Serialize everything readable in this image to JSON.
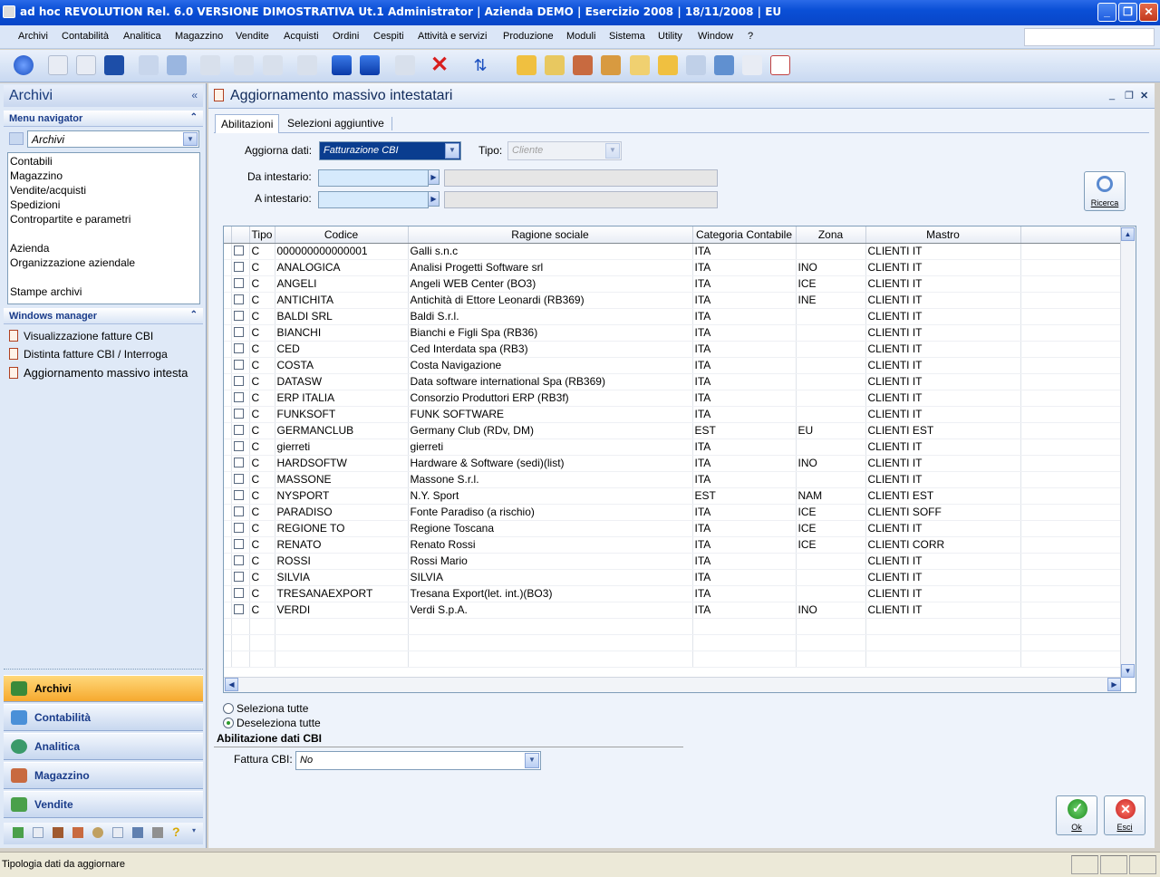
{
  "title_bar": {
    "title": "ad hoc REVOLUTION Rel. 6.0 VERSIONE DIMOSTRATIVA Ut.1 Administrator | Azienda DEMO | Esercizio 2008 | 18/11/2008 | EU"
  },
  "menu": [
    "Archivi",
    "Contabilità",
    "Analitica",
    "Magazzino",
    "Vendite",
    "Acquisti",
    "Ordini",
    "Cespiti",
    "Attività e servizi",
    "Produzione",
    "Moduli",
    "Sistema",
    "Utility",
    "Window",
    "?"
  ],
  "left_panel": {
    "title": "Archivi",
    "menu_navigator": {
      "label": "Menu navigator",
      "selected": "Archivi",
      "items": [
        "Contabili",
        "Magazzino",
        "Vendite/acquisti",
        "Spedizioni",
        "Contropartite e parametri",
        "Azienda",
        "Organizzazione aziendale",
        "Stampe archivi"
      ]
    },
    "windows_manager": {
      "label": "Windows manager",
      "items": [
        "Visualizzazione fatture CBI",
        "Distinta fatture CBI / Interroga",
        "Aggiornamento massivo intesta"
      ]
    },
    "modules": [
      "Archivi",
      "Contabilità",
      "Analitica",
      "Magazzino",
      "Vendite"
    ]
  },
  "main": {
    "title": "Aggiornamento massivo intestatari",
    "tabs": [
      "Abilitazioni",
      "Selezioni aggiuntive"
    ],
    "aggiorna_dati_label": "Aggiorna dati:",
    "aggiorna_dati_value": "Fatturazione CBI",
    "tipo_label": "Tipo:",
    "tipo_value": "Cliente",
    "da_intestario_label": "Da intestario:",
    "a_intestario_label": "A intestario:",
    "ricerca_label": "Ricerca",
    "grid": {
      "columns": [
        "Tipo",
        "Codice",
        "Ragione sociale",
        "Categoria Contabile",
        "Zona",
        "Mastro"
      ],
      "rows": [
        [
          "C",
          "000000000000001",
          "Galli s.n.c",
          "ITA",
          "",
          "CLIENTI IT"
        ],
        [
          "C",
          "ANALOGICA",
          "Analisi Progetti Software srl",
          "ITA",
          "INO",
          "CLIENTI IT"
        ],
        [
          "C",
          "ANGELI",
          "Angeli WEB Center  (BO3)",
          "ITA",
          "ICE",
          "CLIENTI IT"
        ],
        [
          "C",
          "ANTICHITA",
          "Antichità di Ettore Leonardi (RB369)",
          "ITA",
          "INE",
          "CLIENTI IT"
        ],
        [
          "C",
          "BALDI SRL",
          "Baldi S.r.l.",
          "ITA",
          "",
          "CLIENTI IT"
        ],
        [
          "C",
          "BIANCHI",
          "Bianchi e Figli Spa (RB36)",
          "ITA",
          "",
          "CLIENTI IT"
        ],
        [
          "C",
          "CED",
          "Ced Interdata spa (RB3)",
          "ITA",
          "",
          "CLIENTI IT"
        ],
        [
          "C",
          "COSTA",
          "Costa Navigazione",
          "ITA",
          "",
          "CLIENTI IT"
        ],
        [
          "C",
          "DATASW",
          "Data software international  Spa (RB369)",
          "ITA",
          "",
          "CLIENTI IT"
        ],
        [
          "C",
          "ERP ITALIA",
          "Consorzio Produttori ERP (RB3f)",
          "ITA",
          "",
          "CLIENTI IT"
        ],
        [
          "C",
          "FUNKSOFT",
          "FUNK SOFTWARE",
          "ITA",
          "",
          "CLIENTI IT"
        ],
        [
          "C",
          "GERMANCLUB",
          "Germany Club  (RDv, DM)",
          "EST",
          "EU",
          "CLIENTI EST"
        ],
        [
          "C",
          "gierreti",
          "gierreti",
          "ITA",
          "",
          "CLIENTI IT"
        ],
        [
          "C",
          "HARDSOFTW",
          "Hardware & Software  (sedi)(list)",
          "ITA",
          "INO",
          "CLIENTI IT"
        ],
        [
          "C",
          "MASSONE",
          "Massone S.r.l.",
          "ITA",
          "",
          "CLIENTI IT"
        ],
        [
          "C",
          "NYSPORT",
          "N.Y. Sport",
          "EST",
          "NAM",
          "CLIENTI EST"
        ],
        [
          "C",
          "PARADISO",
          "Fonte Paradiso (a rischio)",
          "ITA",
          "ICE",
          "CLIENTI SOFF"
        ],
        [
          "C",
          "REGIONE TO",
          "Regione Toscana",
          "ITA",
          "ICE",
          "CLIENTI IT"
        ],
        [
          "C",
          "RENATO",
          "Renato Rossi",
          "ITA",
          "ICE",
          "CLIENTI CORR"
        ],
        [
          "C",
          "ROSSI",
          "Rossi Mario",
          "ITA",
          "",
          "CLIENTI IT"
        ],
        [
          "C",
          "SILVIA",
          "SILVIA",
          "ITA",
          "",
          "CLIENTI IT"
        ],
        [
          "C",
          "TRESANAEXPORT",
          "Tresana Export(let. int.)(BO3)",
          "ITA",
          "",
          "CLIENTI IT"
        ],
        [
          "C",
          "VERDI",
          "Verdi S.p.A.",
          "ITA",
          "INO",
          "CLIENTI IT"
        ]
      ]
    },
    "seleziona_tutte": "Seleziona tutte",
    "deseleziona_tutte": "Deseleziona tutte",
    "section_label": "Abilitazione dati CBI",
    "fattura_cbi_label": "Fattura CBI:",
    "fattura_cbi_value": "No",
    "ok_label": "Ok",
    "esci_label": "Esci"
  },
  "status_bar": {
    "text": "Tipologia dati da aggiornare"
  }
}
